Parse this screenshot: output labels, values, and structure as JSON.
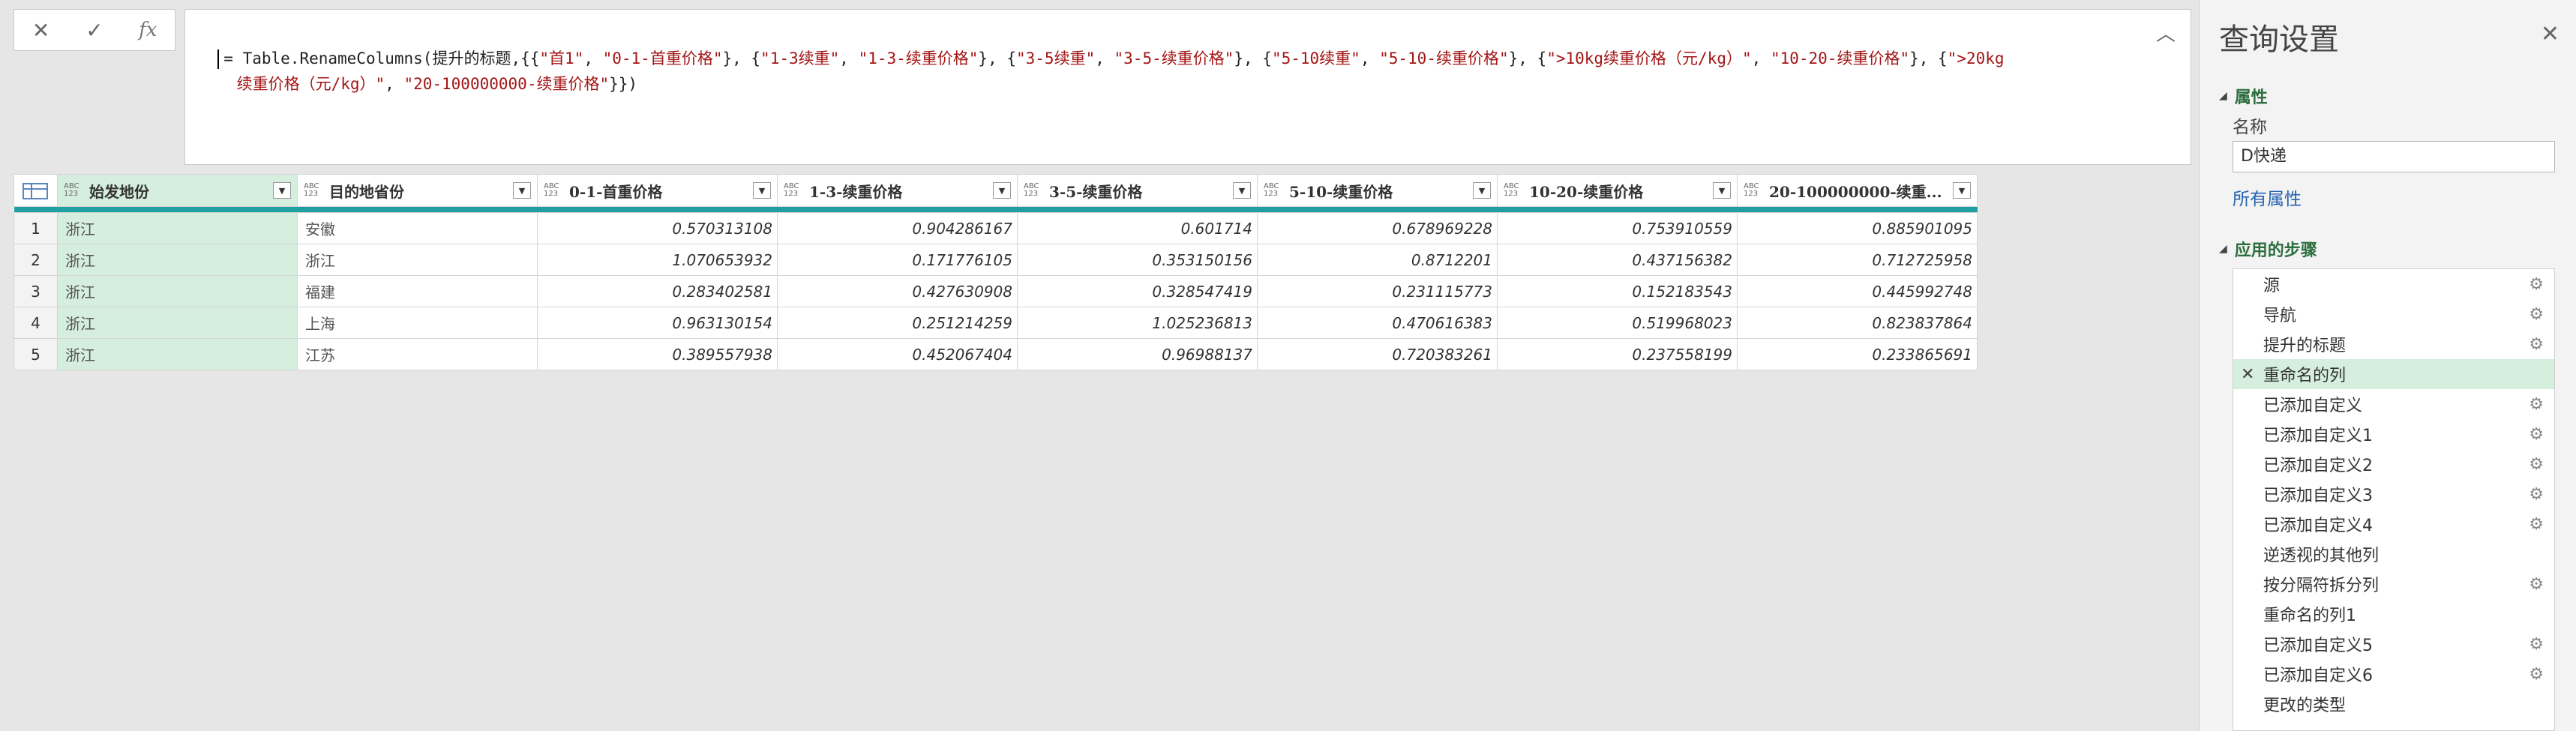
{
  "formula_bar": {
    "cancel_icon": "✕",
    "commit_icon": "✓",
    "fx_label": "fx",
    "formula_prefix": "= Table.RenameColumns(提升的标题,{{",
    "formula_tokens": [
      {
        "t": "\"首1\"",
        "s": 1
      },
      {
        "t": ", ",
        "s": 0
      },
      {
        "t": "\"0-1-首重价格\"",
        "s": 1
      },
      {
        "t": "}, {",
        "s": 0
      },
      {
        "t": "\"1-3续重\"",
        "s": 1
      },
      {
        "t": ", ",
        "s": 0
      },
      {
        "t": "\"1-3-续重价格\"",
        "s": 1
      },
      {
        "t": "}, {",
        "s": 0
      },
      {
        "t": "\"3-5续重\"",
        "s": 1
      },
      {
        "t": ", ",
        "s": 0
      },
      {
        "t": "\"3-5-续重价格\"",
        "s": 1
      },
      {
        "t": "}, {",
        "s": 0
      },
      {
        "t": "\"5-10续重\"",
        "s": 1
      },
      {
        "t": ", ",
        "s": 0
      },
      {
        "t": "\"5-10-续重价格\"",
        "s": 1
      },
      {
        "t": "}, {",
        "s": 0
      },
      {
        "t": "\">10kg续重价格（元/kg）\"",
        "s": 1
      },
      {
        "t": ", ",
        "s": 0
      },
      {
        "t": "\"10-20-续重价格\"",
        "s": 1
      },
      {
        "t": "}, {",
        "s": 0
      },
      {
        "t": "\">20kg\n    续重价格（元/kg）\"",
        "s": 1
      },
      {
        "t": ", ",
        "s": 0
      },
      {
        "t": "\"20-100000000-续重价格\"",
        "s": 1
      },
      {
        "t": "}})",
        "s": 0
      }
    ],
    "collapse_icon": "︿"
  },
  "table": {
    "columns": [
      {
        "type_top": "ABC",
        "type_bottom": "123",
        "label": "始发地份"
      },
      {
        "type_top": "ABC",
        "type_bottom": "123",
        "label": "目的地省份"
      },
      {
        "type_top": "ABC",
        "type_bottom": "123",
        "label": "0-1-首重价格"
      },
      {
        "type_top": "ABC",
        "type_bottom": "123",
        "label": "1-3-续重价格"
      },
      {
        "type_top": "ABC",
        "type_bottom": "123",
        "label": "3-5-续重价格"
      },
      {
        "type_top": "ABC",
        "type_bottom": "123",
        "label": "5-10-续重价格"
      },
      {
        "type_top": "ABC",
        "type_bottom": "123",
        "label": "10-20-续重价格"
      },
      {
        "type_top": "ABC",
        "type_bottom": "123",
        "label": "20-100000000-续重..."
      }
    ],
    "rows": [
      {
        "n": "1",
        "cells": [
          "浙江",
          "安徽",
          "0.570313108",
          "0.904286167",
          "0.601714",
          "0.678969228",
          "0.753910559",
          "0.885901095"
        ]
      },
      {
        "n": "2",
        "cells": [
          "浙江",
          "浙江",
          "1.070653932",
          "0.171776105",
          "0.353150156",
          "0.8712201",
          "0.437156382",
          "0.712725958"
        ]
      },
      {
        "n": "3",
        "cells": [
          "浙江",
          "福建",
          "0.283402581",
          "0.427630908",
          "0.328547419",
          "0.231115773",
          "0.152183543",
          "0.445992748"
        ]
      },
      {
        "n": "4",
        "cells": [
          "浙江",
          "上海",
          "0.963130154",
          "0.251214259",
          "1.025236813",
          "0.470616383",
          "0.519968023",
          "0.823837864"
        ]
      },
      {
        "n": "5",
        "cells": [
          "浙江",
          "江苏",
          "0.389557938",
          "0.452067404",
          "0.96988137",
          "0.720383261",
          "0.237558199",
          "0.233865691"
        ]
      }
    ],
    "dropdown_icon": "▼"
  },
  "query_settings": {
    "title": "查询设置",
    "close_icon": "✕",
    "properties_header": "属性",
    "name_label": "名称",
    "name_value": "D快递",
    "all_properties_link": "所有属性",
    "applied_steps_header": "应用的步骤",
    "collapse_glyph": "◢",
    "steps": [
      {
        "label": "源",
        "gear": true,
        "active": false
      },
      {
        "label": "导航",
        "gear": true,
        "active": false
      },
      {
        "label": "提升的标题",
        "gear": true,
        "active": false
      },
      {
        "label": "重命名的列",
        "gear": false,
        "active": true
      },
      {
        "label": "已添加自定义",
        "gear": true,
        "active": false
      },
      {
        "label": "已添加自定义1",
        "gear": true,
        "active": false
      },
      {
        "label": "已添加自定义2",
        "gear": true,
        "active": false
      },
      {
        "label": "已添加自定义3",
        "gear": true,
        "active": false
      },
      {
        "label": "已添加自定义4",
        "gear": true,
        "active": false
      },
      {
        "label": "逆透视的其他列",
        "gear": false,
        "active": false
      },
      {
        "label": "按分隔符拆分列",
        "gear": true,
        "active": false
      },
      {
        "label": "重命名的列1",
        "gear": false,
        "active": false
      },
      {
        "label": "已添加自定义5",
        "gear": true,
        "active": false
      },
      {
        "label": "已添加自定义6",
        "gear": true,
        "active": false
      },
      {
        "label": "更改的类型",
        "gear": false,
        "active": false
      }
    ],
    "gear_icon": "⚙",
    "delete_step_icon": "✕"
  }
}
